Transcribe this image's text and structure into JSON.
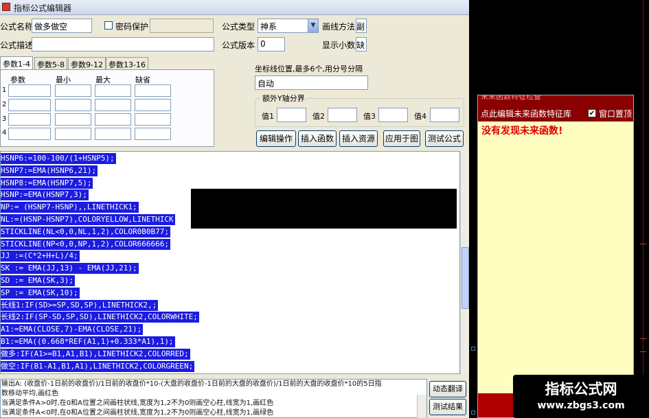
{
  "window": {
    "title": "指标公式编辑器"
  },
  "form": {
    "name_label": "公式名称",
    "name_value": "做多做空",
    "password_label": "密码保护",
    "desc_label": "公式描述",
    "type_label": "公式类型",
    "type_value": "神系",
    "version_label": "公式版本",
    "version_value": "0",
    "draw_method_label": "画线方法",
    "draw_method_value": "副",
    "decimals_label": "显示小数",
    "decimals_value": "缺"
  },
  "param_tabs": [
    "参数1-4",
    "参数5-8",
    "参数9-12",
    "参数13-16"
  ],
  "param_headers": [
    "参数",
    "最小",
    "最大",
    "缺省"
  ],
  "param_rows": [
    "1",
    "2",
    "3",
    "4"
  ],
  "coord": {
    "label": "坐标线位置,最多6个,用分号分隔",
    "value": "自动"
  },
  "y_axis": {
    "legend": "额外Y轴分界",
    "labels": [
      "值1",
      "值2",
      "值3",
      "值4"
    ]
  },
  "buttons": {
    "edit": "编辑操作",
    "insert_func": "插入函数",
    "insert_res": "插入资源",
    "apply": "应用于图",
    "test": "测试公式",
    "dyn_translate": "动态翻译",
    "test_result": "测试结果"
  },
  "code_lines": [
    "HSNP6:=100-100/(1+HSNP5);",
    "HSNP7:=EMA(HSNP6,21);",
    "HSNP8:=EMA(HSNP7,5);",
    "HSNP:=EMA(HSNP7,3);",
    "NP:= (HSNP7-HSNP),,LINETHICK1;",
    "NL:=(HSNP-HSNP7),COLORYELLOW,LINETHICK",
    "STICKLINE(NL<0,0,NL,1,2),COLOR0B0B77;",
    "STICKLINE(NP<0,0,NP,1,2),COLOR666666;",
    "JJ :=(C*2+H+L)/4;",
    "SK := EMA(JJ,13) - EMA(JJ,21);",
    "SD := EMA(SK,3);",
    "SP := EMA(SK,10);",
    "长线1:IF(SD>=SP,SD,SP),LINETHICK2,;",
    "长线2:IF(SP-SD,SP,SD),LINETHICK2,COLORWHITE;",
    "A1:=EMA(CLOSE,7)-EMA(CLOSE,21);",
    "B1:=EMA((0.668*REF(A1,1)+0.333*A1),1);",
    "做多:IF(A1>=B1,A1,B1),LINETHICK2,COLORRED;",
    "做空:IF(B1-A1,B1,A1),LINETHICK2,COLORGREEN;"
  ],
  "output_lines": [
    "输出A: (收盘价-1日前的收盘价)/1日前的收盘价*10-(大盘的收盘价-1日前的大盘的收盘价)/1日前的大盘的收盘价*10的5日指",
    "数移动平均,画红色",
    "当满足条件A>0时,在0和A位置之间画柱状线,宽度为1,2不为0则画空心柱,线宽为1,画红色",
    "当满足条件A<0时,在0和A位置之间画柱状线,宽度为1,2不为0则画空心柱,线宽为1,画绿色"
  ],
  "right_panel": {
    "title_cut": "未来函数特征检查",
    "header": "点此编辑未来函数特征库",
    "topmost_label": "窗口置顶",
    "warning": "没有发现未来函数!"
  },
  "watermark": {
    "line1": "指标公式网",
    "line2": "www.zbgs3.com"
  },
  "colors": {
    "code_bg": "#1c1ce0",
    "panel_bg": "#fefec0",
    "panel_header": "#8a0000",
    "warning": "#e00000"
  }
}
